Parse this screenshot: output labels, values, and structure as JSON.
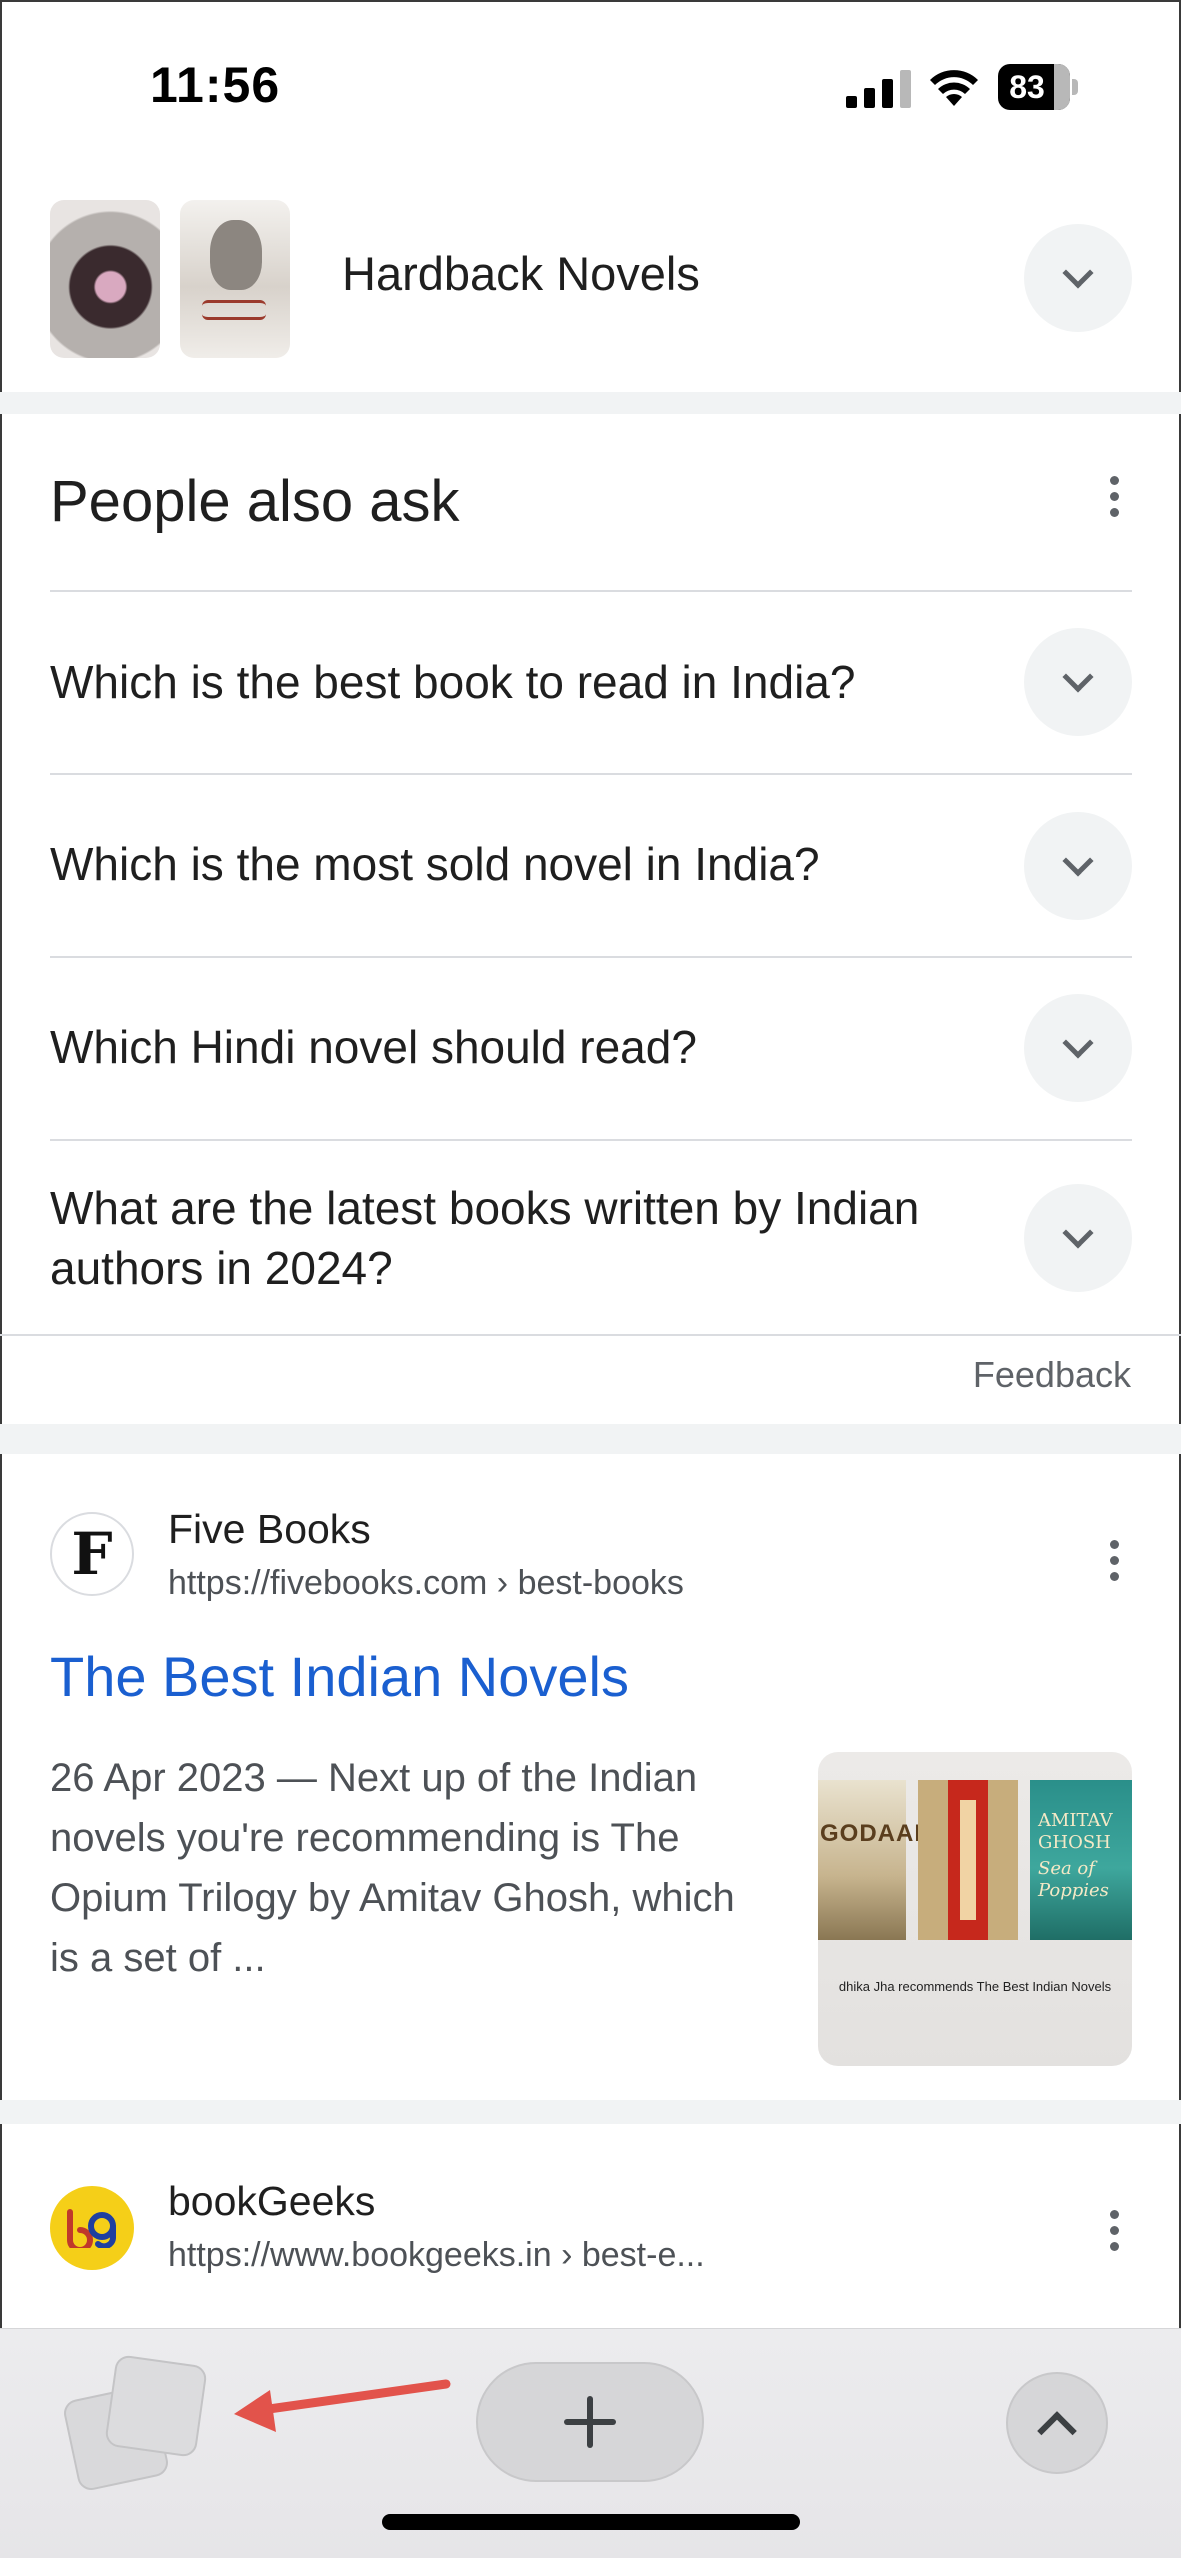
{
  "status_bar": {
    "time": "11:56",
    "battery": "83",
    "icons": [
      "cellular-signal-icon",
      "wifi-icon",
      "battery-icon"
    ]
  },
  "header": {
    "title": "Hardback Novels",
    "expand_icon": "chevron-down-icon"
  },
  "people_also_ask": {
    "title": "People also ask",
    "questions": [
      "Which is the best book to read in India?",
      "Which is the most sold novel in India?",
      "Which Hindi novel should read?",
      "What are the latest books written by Indian authors in 2024?"
    ],
    "feedback_label": "Feedback"
  },
  "results": [
    {
      "site_name": "Five Books",
      "favicon_letter": "F",
      "url": "https://fivebooks.com › best-books",
      "title": "The Best Indian Novels",
      "snippet": "26 Apr 2023 — Next up of the Indian novels you're recommending is The Opium Trilogy by Amitav Ghosh, which is a set of ...",
      "image": {
        "book1": "GODAAN",
        "book3": "AMITAV GHOSH",
        "book3_sub": "Sea of Poppies",
        "caption": "dhika Jha recommends The Best Indian Novels"
      }
    },
    {
      "site_name": "bookGeeks",
      "favicon_letter": "bg",
      "url": "https://www.bookgeeks.in › best-e..."
    }
  ],
  "toolbar": {
    "tabs_icon": "tabs-icon",
    "new_tab_icon": "plus-icon",
    "scroll_top_icon": "chevron-up-icon"
  },
  "colors": {
    "link_blue": "#1a5fd0",
    "annotation_arrow": "#e2534b",
    "favicon_bookgeeks": "#f5cf18"
  }
}
